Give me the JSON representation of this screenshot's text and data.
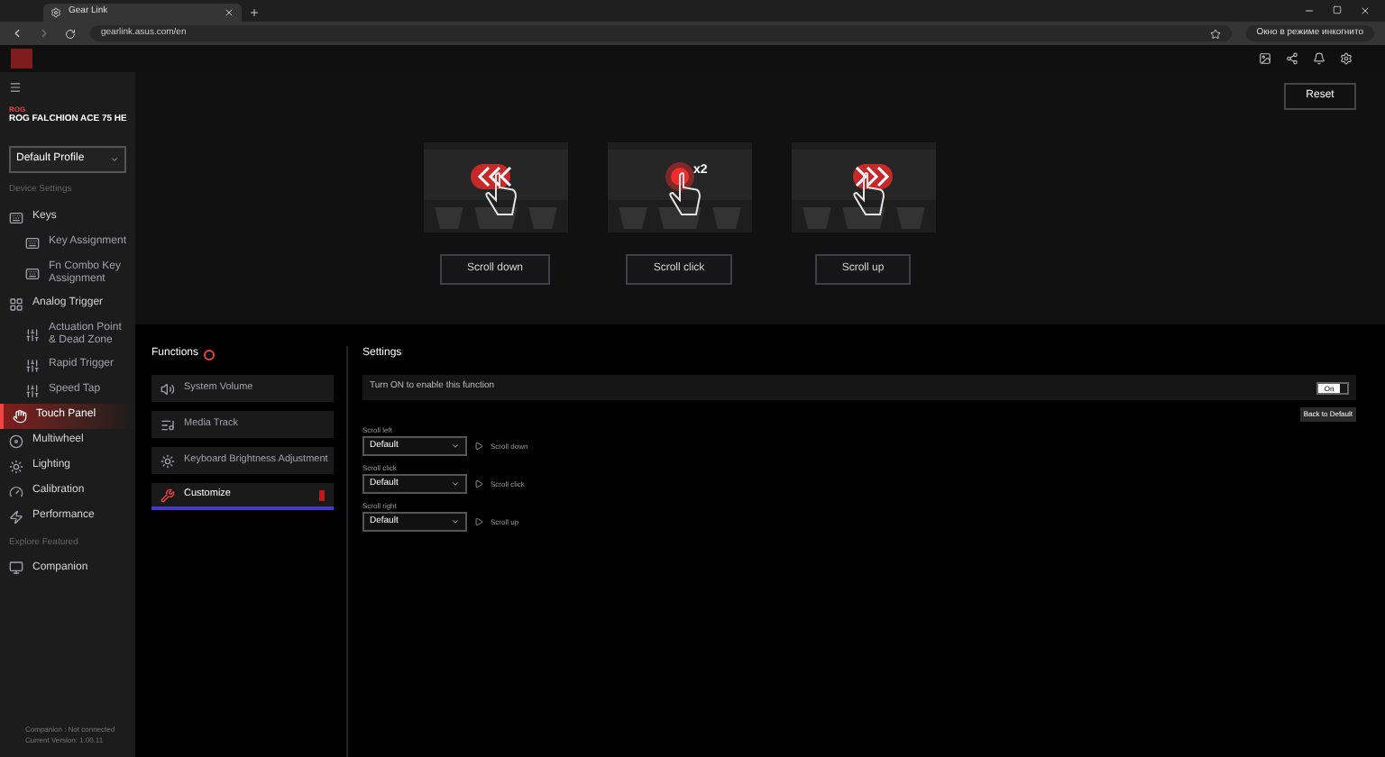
{
  "browser": {
    "tab_title": "Gear Link",
    "url": "gearlink.asus.com/en",
    "incognito_label": "Окно в режиме инкогнито"
  },
  "app_header": {
    "reset_label": "Reset"
  },
  "sidebar": {
    "brand": "ROG",
    "device_name": "ROG FALCHION ACE 75 HE",
    "profile": "Default Profile",
    "section_label": "Device Settings",
    "items": [
      {
        "label": "Keys",
        "kind": "keyboard",
        "selected": false,
        "children": [
          {
            "label": "Key Assignment",
            "kind": "keyboard",
            "selected": false
          },
          {
            "label": "Fn Combo Key Assignment",
            "kind": "fn",
            "selected": false
          }
        ]
      },
      {
        "label": "Analog Trigger",
        "kind": "grid",
        "selected": false,
        "children": [
          {
            "label": "Actuation Point & Dead Zone",
            "kind": "sliders",
            "selected": false
          },
          {
            "label": "Rapid Trigger",
            "kind": "sliders",
            "selected": false
          },
          {
            "label": "Speed Tap",
            "kind": "sliders",
            "selected": false
          }
        ]
      },
      {
        "label": "Touch Panel",
        "kind": "touch",
        "selected": true
      },
      {
        "label": "Multiwheel",
        "kind": "wheel",
        "selected": false
      },
      {
        "label": "Lighting",
        "kind": "sun",
        "selected": false
      },
      {
        "label": "Calibration",
        "kind": "gauge",
        "selected": false
      },
      {
        "label": "Performance",
        "kind": "perf",
        "selected": false
      }
    ],
    "explore_label": "Explore Featured",
    "explore_items": [
      {
        "label": "Companion",
        "kind": "monitor",
        "selected": false
      }
    ],
    "footer": [
      "Companion : Not connected",
      "Current Version: 1.00.11"
    ]
  },
  "gestures": [
    {
      "kind": "left",
      "label": "Scroll down"
    },
    {
      "kind": "click",
      "badge": "x2",
      "label": "Scroll click"
    },
    {
      "kind": "right",
      "label": "Scroll up"
    }
  ],
  "functions": {
    "title": "Functions",
    "items": [
      {
        "label": "System Volume",
        "kind": "volume",
        "selected": false
      },
      {
        "label": "Media Track",
        "kind": "media",
        "selected": false
      },
      {
        "label": "Keyboard Brightness Adjustment",
        "kind": "sun",
        "selected": false
      },
      {
        "label": "Customize",
        "kind": "custom",
        "selected": true
      }
    ]
  },
  "settings": {
    "title": "Settings",
    "enable_text": "Turn ON to enable this function",
    "toggle": {
      "label": "On",
      "on": true
    },
    "back_label": "Back to Default",
    "rows": [
      {
        "label": "Scroll left",
        "value": "Default",
        "result": "Scroll down"
      },
      {
        "label": "Scroll click",
        "value": "Default",
        "result": "Scroll click"
      },
      {
        "label": "Scroll right",
        "value": "Default",
        "result": "Scroll up"
      }
    ]
  }
}
